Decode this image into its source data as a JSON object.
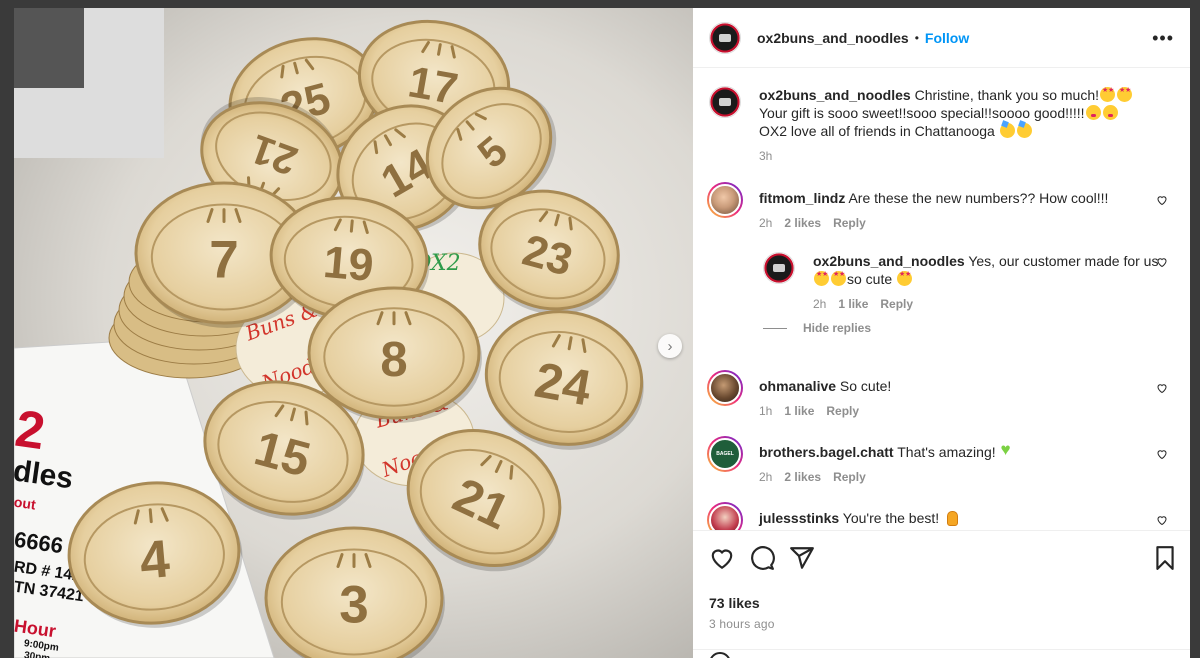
{
  "post": {
    "username": "ox2buns_and_noodles",
    "follow_label": "Follow",
    "separator": "•",
    "more_label": "•••"
  },
  "caption": {
    "username": "ox2buns_and_noodles",
    "text_line1": "Christine, thank you so much!",
    "text_line2": "Your gift is sooo sweet!!sooo special!!soooo good!!!!!",
    "text_line3": "OX2 love all of friends in Chattanooga",
    "time": "3h"
  },
  "comments": [
    {
      "username": "fitmom_lindz",
      "text": "Are these the new numbers?? How cool!!!",
      "time": "2h",
      "likes": "2 likes",
      "reply": "Reply"
    },
    {
      "username": "ox2buns_and_noodles",
      "text": "Yes, our customer made for us",
      "text2": "so cute",
      "time": "2h",
      "likes": "1 like",
      "reply": "Reply"
    },
    {
      "username": "ohmanalive",
      "text": "So cute!",
      "time": "1h",
      "likes": "1 like",
      "reply": "Reply"
    },
    {
      "username": "brothers.bagel.chatt",
      "text": "That's amazing!",
      "time": "2h",
      "likes": "2 likes",
      "reply": "Reply"
    },
    {
      "username": "julessstinks",
      "text": "You're the best!"
    }
  ],
  "hide_replies": "Hide replies",
  "footer": {
    "likes": "73 likes",
    "time": "3 hours ago"
  },
  "photo": {
    "tokens": [
      "25",
      "17",
      "21",
      "14",
      "5",
      "7",
      "19",
      "23",
      "8",
      "24",
      "15",
      "4",
      "21",
      "3"
    ],
    "handwritten": [
      "OX2",
      "Buns &",
      "Noodles",
      "Buns &",
      "Noodles"
    ],
    "menu_fragments": [
      "2",
      "dles",
      "out",
      "6666",
      "RD # 142",
      "TN 37421",
      "Hour",
      "9:00pm",
      "30pm"
    ],
    "next_arrow": "›"
  },
  "colors": {
    "accent": "#0095f6",
    "text": "#262626",
    "muted": "#8e8e8e",
    "wood": "#e8d3a8",
    "burn": "#a88a55"
  }
}
